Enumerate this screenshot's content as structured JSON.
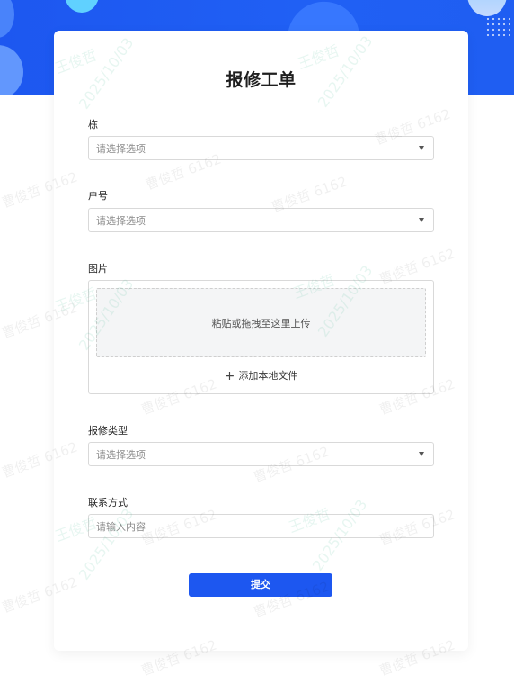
{
  "form": {
    "title": "报修工单",
    "fields": {
      "building": {
        "label": "栋",
        "placeholder": "请选择选项"
      },
      "unit": {
        "label": "户号",
        "placeholder": "请选择选项"
      },
      "images": {
        "label": "图片",
        "drop_text": "粘贴或拖拽至这里上传",
        "add_label": "添加本地文件",
        "add_icon": "plus-icon"
      },
      "repair_type": {
        "label": "报修类型",
        "placeholder": "请选择选项"
      },
      "contact": {
        "label": "联系方式",
        "placeholder": "请输入内容"
      }
    },
    "submit_label": "提交"
  },
  "watermark": {
    "name_text": "曹俊哲 6162",
    "date_text": "2025/10/03",
    "sig_text": "王俊哲"
  },
  "colors": {
    "primary": "#1d57f0",
    "banner": "#2060f4",
    "placeholder": "#8c8c8c",
    "border": "#d9d9d9"
  }
}
